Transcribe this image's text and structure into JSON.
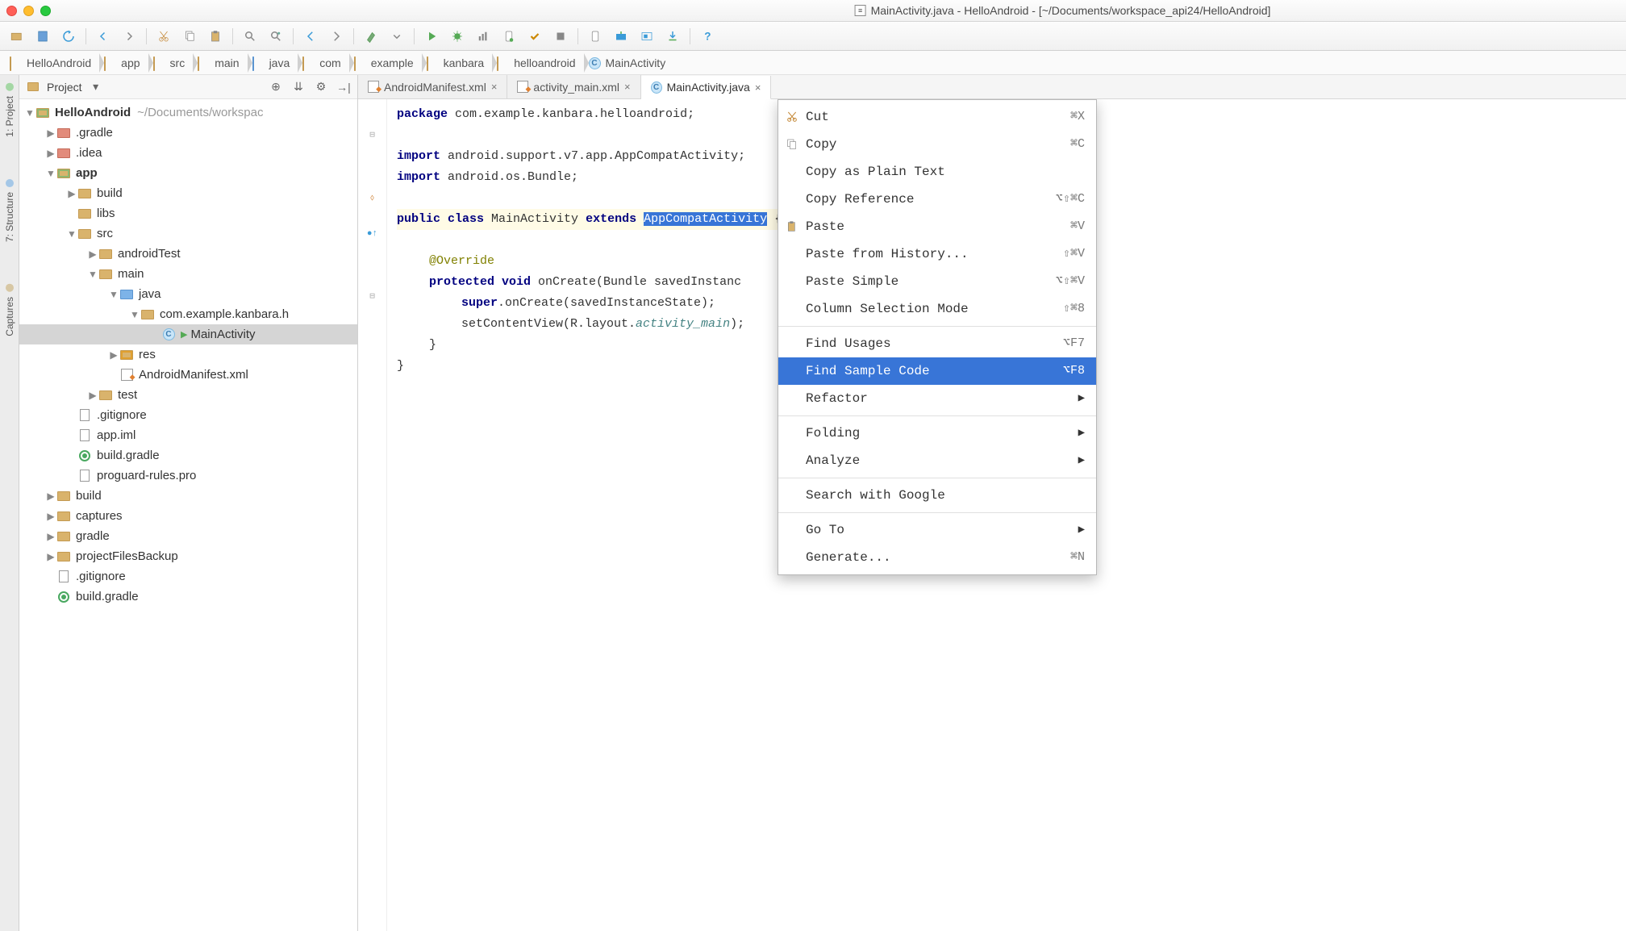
{
  "window": {
    "title": "MainActivity.java - HelloAndroid - [~/Documents/workspace_api24/HelloAndroid]"
  },
  "breadcrumb": [
    {
      "label": "HelloAndroid",
      "icon": "module"
    },
    {
      "label": "app",
      "icon": "module"
    },
    {
      "label": "src",
      "icon": "folder"
    },
    {
      "label": "main",
      "icon": "folder"
    },
    {
      "label": "java",
      "icon": "folder-blue"
    },
    {
      "label": "com",
      "icon": "folder"
    },
    {
      "label": "example",
      "icon": "folder"
    },
    {
      "label": "kanbara",
      "icon": "folder"
    },
    {
      "label": "helloandroid",
      "icon": "folder"
    },
    {
      "label": "MainActivity",
      "icon": "class"
    }
  ],
  "siderail": [
    "1: Project",
    "7: Structure",
    "Captures"
  ],
  "project_panel": {
    "title": "Project",
    "tree": [
      {
        "depth": 0,
        "arrow": "down",
        "icon": "module",
        "label": "HelloAndroid",
        "path": "~/Documents/workspac",
        "root": true
      },
      {
        "depth": 1,
        "arrow": "right",
        "icon": "folder-red",
        "label": ".gradle"
      },
      {
        "depth": 1,
        "arrow": "right",
        "icon": "folder-red",
        "label": ".idea"
      },
      {
        "depth": 1,
        "arrow": "down",
        "icon": "module",
        "label": "app",
        "root": true
      },
      {
        "depth": 2,
        "arrow": "right",
        "icon": "folder",
        "label": "build"
      },
      {
        "depth": 2,
        "arrow": "none",
        "icon": "folder",
        "label": "libs"
      },
      {
        "depth": 2,
        "arrow": "down",
        "icon": "folder",
        "label": "src"
      },
      {
        "depth": 3,
        "arrow": "right",
        "icon": "folder",
        "label": "androidTest"
      },
      {
        "depth": 3,
        "arrow": "down",
        "icon": "folder",
        "label": "main"
      },
      {
        "depth": 4,
        "arrow": "down",
        "icon": "folder-blue",
        "label": "java"
      },
      {
        "depth": 5,
        "arrow": "down",
        "icon": "folder",
        "label": "com.example.kanbara.h"
      },
      {
        "depth": 6,
        "arrow": "none",
        "icon": "class",
        "label": "MainActivity",
        "selected": true,
        "runnable": true
      },
      {
        "depth": 4,
        "arrow": "right",
        "icon": "folder-res",
        "label": "res"
      },
      {
        "depth": 4,
        "arrow": "none",
        "icon": "xml",
        "label": "AndroidManifest.xml"
      },
      {
        "depth": 3,
        "arrow": "right",
        "icon": "folder",
        "label": "test"
      },
      {
        "depth": 2,
        "arrow": "none",
        "icon": "file",
        "label": ".gitignore"
      },
      {
        "depth": 2,
        "arrow": "none",
        "icon": "file",
        "label": "app.iml"
      },
      {
        "depth": 2,
        "arrow": "none",
        "icon": "gradle",
        "label": "build.gradle"
      },
      {
        "depth": 2,
        "arrow": "none",
        "icon": "file",
        "label": "proguard-rules.pro"
      },
      {
        "depth": 1,
        "arrow": "right",
        "icon": "folder",
        "label": "build"
      },
      {
        "depth": 1,
        "arrow": "right",
        "icon": "folder",
        "label": "captures"
      },
      {
        "depth": 1,
        "arrow": "right",
        "icon": "folder",
        "label": "gradle"
      },
      {
        "depth": 1,
        "arrow": "right",
        "icon": "folder",
        "label": "projectFilesBackup"
      },
      {
        "depth": 1,
        "arrow": "none",
        "icon": "file",
        "label": ".gitignore"
      },
      {
        "depth": 1,
        "arrow": "none",
        "icon": "gradle",
        "label": "build.gradle"
      }
    ]
  },
  "editor_tabs": [
    {
      "label": "AndroidManifest.xml",
      "icon": "xml",
      "active": false
    },
    {
      "label": "activity_main.xml",
      "icon": "xml",
      "active": false
    },
    {
      "label": "MainActivity.java",
      "icon": "class",
      "active": true
    }
  ],
  "code": {
    "l1": {
      "pkg": "package",
      "rest": " com.example.kanbara.helloandroid;"
    },
    "l2": "",
    "l3a": "import",
    "l3b": " android.support.v7.app.AppCompatActivity;",
    "l4a": "import",
    "l4b": " android.os.Bundle;",
    "l5": "",
    "l6a": "public class",
    "l6b": " MainActivity ",
    "l6c": "extends",
    "l6d": " ",
    "l6sel": "AppCompatActivity",
    "l6e": " {",
    "l7": "",
    "l8": "@Override",
    "l9a": "protected void",
    "l9b": " onCreate(Bundle savedInstanc",
    "l10a": "super",
    "l10b": ".onCreate(savedInstanceState);",
    "l11a": "setContentView(R.layout.",
    "l11b": "activity_main",
    "l11c": ");",
    "l12": "}",
    "l13": "}"
  },
  "context_menu": [
    {
      "label": "Cut",
      "shortcut": "⌘X",
      "icon": "cut"
    },
    {
      "label": "Copy",
      "shortcut": "⌘C",
      "icon": "copy"
    },
    {
      "label": "Copy as Plain Text"
    },
    {
      "label": "Copy Reference",
      "shortcut": "⌥⇧⌘C"
    },
    {
      "label": "Paste",
      "shortcut": "⌘V",
      "icon": "paste"
    },
    {
      "label": "Paste from History...",
      "shortcut": "⇧⌘V"
    },
    {
      "label": "Paste Simple",
      "shortcut": "⌥⇧⌘V"
    },
    {
      "label": "Column Selection Mode",
      "shortcut": "⇧⌘8"
    },
    {
      "sep": true
    },
    {
      "label": "Find Usages",
      "shortcut": "⌥F7"
    },
    {
      "label": "Find Sample Code",
      "shortcut": "⌥F8",
      "selected": true
    },
    {
      "label": "Refactor",
      "submenu": true
    },
    {
      "sep": true
    },
    {
      "label": "Folding",
      "submenu": true
    },
    {
      "label": "Analyze",
      "submenu": true
    },
    {
      "sep": true
    },
    {
      "label": "Search with Google"
    },
    {
      "sep": true
    },
    {
      "label": "Go To",
      "submenu": true
    },
    {
      "label": "Generate...",
      "shortcut": "⌘N"
    }
  ]
}
